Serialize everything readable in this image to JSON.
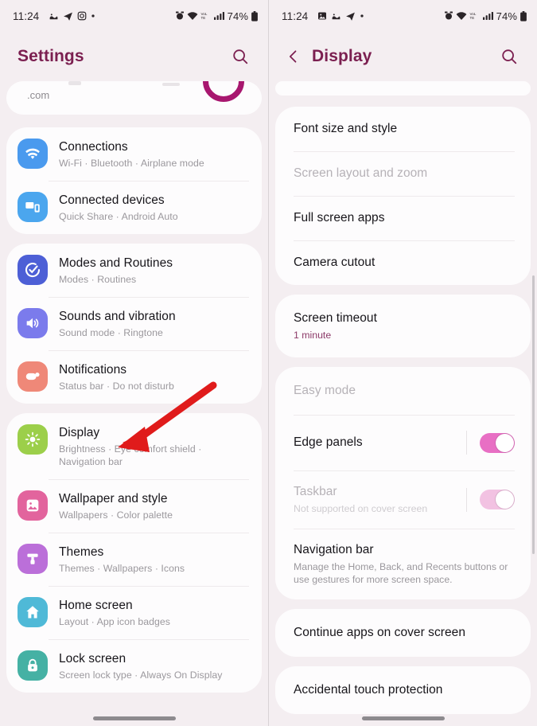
{
  "status_bar": {
    "time": "11:24",
    "battery_text": "74%",
    "left_icons_left_screen": [
      "photos-icon",
      "telegram-icon",
      "instagram-icon",
      "dot-icon"
    ],
    "left_icons_right_screen": [
      "gallery-icon",
      "photos-icon",
      "telegram-icon",
      "dot-icon"
    ],
    "right_icons": [
      "alarm-icon",
      "wifi-icon",
      "volte-icon",
      "signal-icon",
      "battery-icon"
    ]
  },
  "left_screen": {
    "app_bar": {
      "title": "Settings",
      "search_icon": "search-icon"
    },
    "partial_card": {
      "text": ".com"
    },
    "groups": [
      {
        "rows": [
          {
            "title": "Connections",
            "subtitle": "Wi-Fi  ·  Bluetooth  ·  Airplane mode",
            "icon": "wifi-icon",
            "icon_color": "#4a9aee"
          },
          {
            "title": "Connected devices",
            "subtitle": "Quick Share  ·  Android Auto",
            "icon": "connected-devices-icon",
            "icon_color": "#4ba6ee"
          }
        ]
      },
      {
        "rows": [
          {
            "title": "Modes and Routines",
            "subtitle": "Modes  ·  Routines",
            "icon": "modes-routines-icon",
            "icon_color": "#4d5fd6"
          },
          {
            "title": "Sounds and vibration",
            "subtitle": "Sound mode  ·  Ringtone",
            "icon": "sound-icon",
            "icon_color": "#7b7bec"
          },
          {
            "title": "Notifications",
            "subtitle": "Status bar  ·  Do not disturb",
            "icon": "notifications-icon",
            "icon_color": "#ef8878"
          }
        ]
      },
      {
        "rows": [
          {
            "title": "Display",
            "subtitle": "Brightness  ·  Eye comfort shield  ·  Navigation bar",
            "icon": "display-icon",
            "icon_color": "#9ccf4a"
          },
          {
            "title": "Wallpaper and style",
            "subtitle": "Wallpapers  ·  Color palette",
            "icon": "wallpaper-icon",
            "icon_color": "#e2649d"
          },
          {
            "title": "Themes",
            "subtitle": "Themes  ·  Wallpapers  ·  Icons",
            "icon": "themes-icon",
            "icon_color": "#bb6fd9"
          },
          {
            "title": "Home screen",
            "subtitle": "Layout  ·  App icon badges",
            "icon": "home-screen-icon",
            "icon_color": "#4fb9d7"
          },
          {
            "title": "Lock screen",
            "subtitle": "Screen lock type  ·  Always On Display",
            "icon": "lock-screen-icon",
            "icon_color": "#45b1a4"
          }
        ]
      }
    ]
  },
  "right_screen": {
    "app_bar": {
      "title": "Display",
      "back_icon": "back-chevron-icon",
      "search_icon": "search-icon"
    },
    "groups": [
      {
        "rows": [
          {
            "title": "Font size and style",
            "dim": false
          },
          {
            "title": "Screen layout and zoom",
            "dim": true
          },
          {
            "title": "Full screen apps",
            "dim": false
          },
          {
            "title": "Camera cutout",
            "dim": false
          }
        ]
      },
      {
        "rows": [
          {
            "title": "Screen timeout",
            "subtitle": "1 minute",
            "subtitle_style": "accent",
            "dim": false
          }
        ]
      },
      {
        "rows": [
          {
            "title": "Easy mode",
            "dim": true
          },
          {
            "title": "Edge panels",
            "dim": false,
            "toggle": "on"
          },
          {
            "title": "Taskbar",
            "subtitle": "Not supported on cover screen",
            "subtitle_style": "dim",
            "dim": true,
            "toggle": "on-disabled"
          },
          {
            "title": "Navigation bar",
            "subtitle": "Manage the Home, Back, and Recents buttons or use gestures for more screen space.",
            "dim": false
          }
        ]
      },
      {
        "rows": [
          {
            "title": "Continue apps on cover screen",
            "dim": false
          }
        ]
      },
      {
        "rows": [
          {
            "title": "Accidental touch protection",
            "dim": false
          }
        ]
      }
    ]
  },
  "annotations": {
    "arrow_color": "#e01b1b",
    "arrows": [
      {
        "name": "arrow-pointing-to-display",
        "target": "Display"
      },
      {
        "name": "arrow-pointing-to-edge-panels",
        "target": "Edge panels"
      }
    ]
  },
  "colors": {
    "accent": "#7b1f50",
    "toggle_on": "#e86fc4",
    "background": "#f4eef1",
    "card": "#fdfcfd"
  }
}
